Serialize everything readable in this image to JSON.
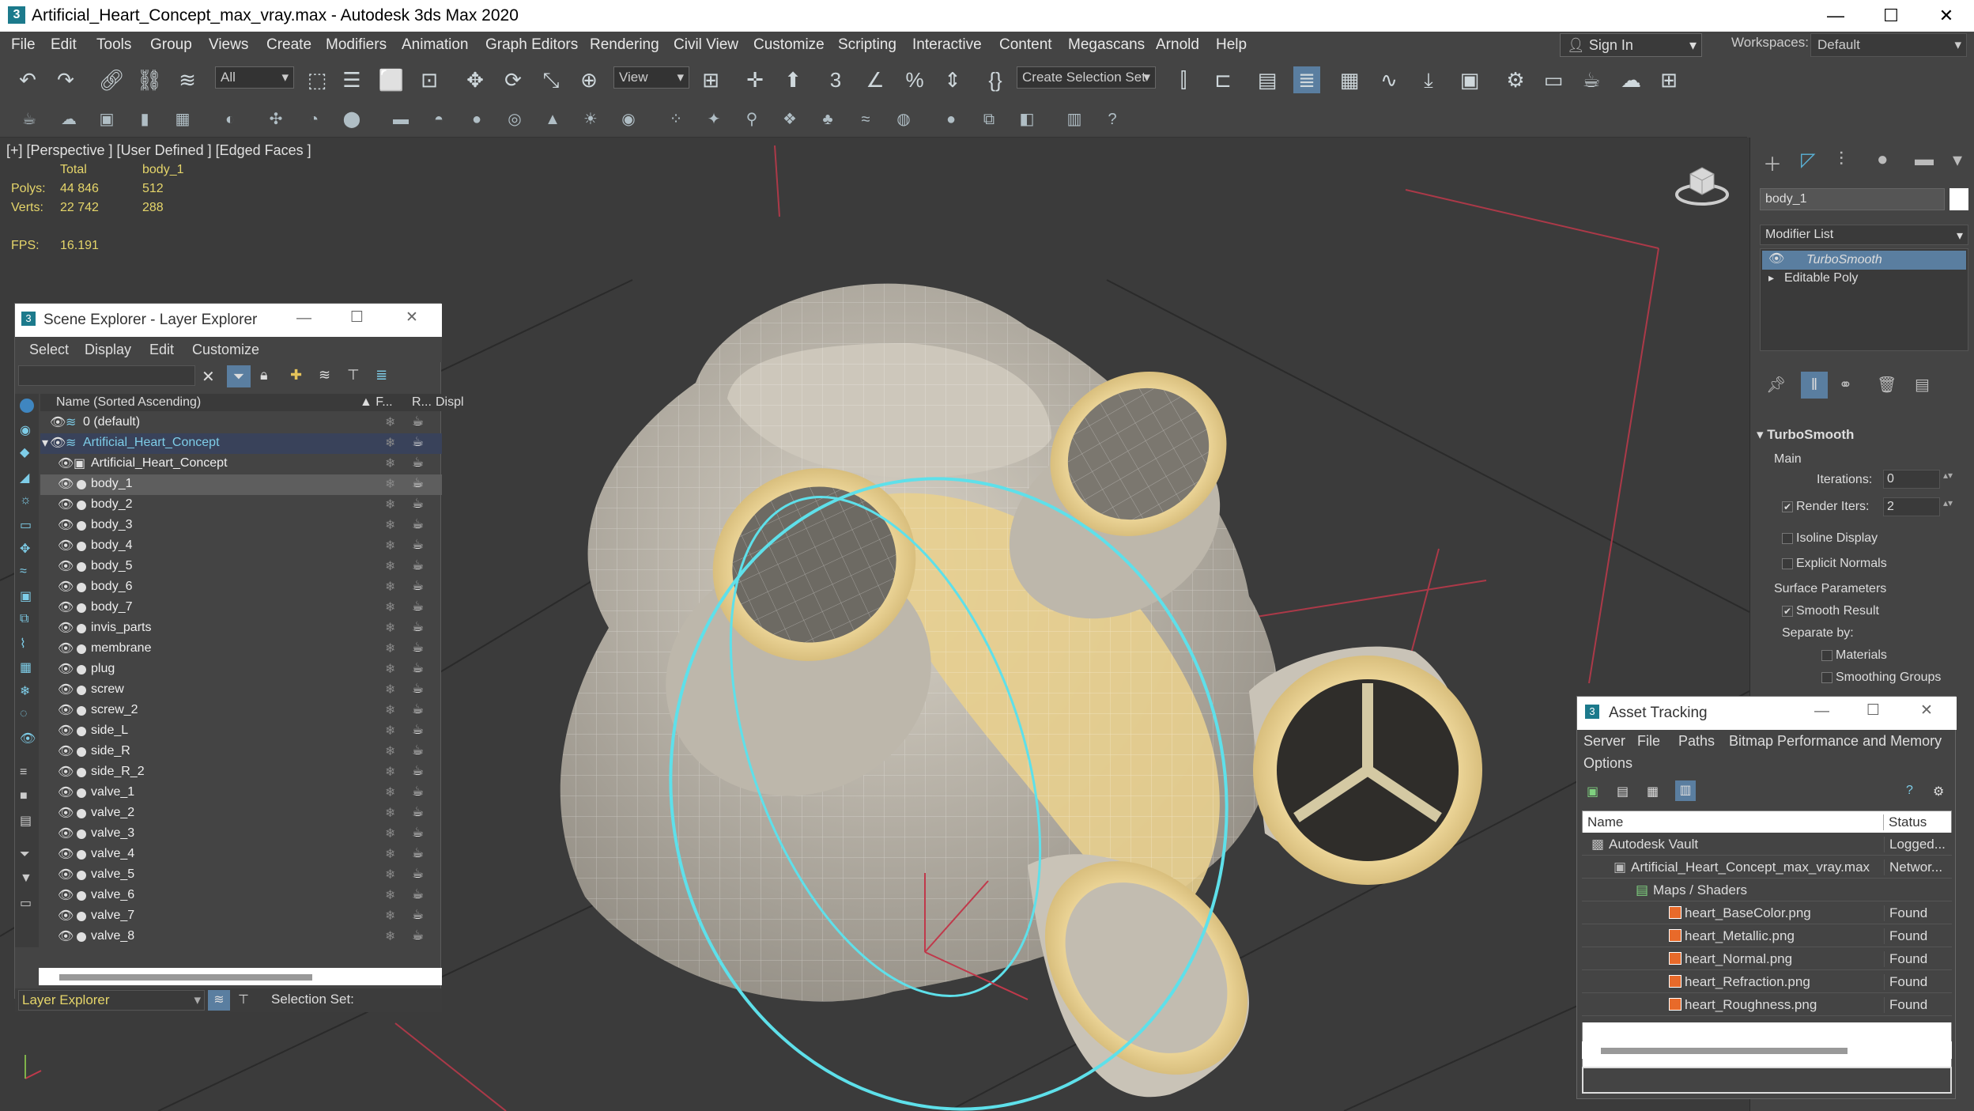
{
  "titlebar": {
    "title": "Artificial_Heart_Concept_max_vray.max - Autodesk 3ds Max 2020",
    "min": "—",
    "max": "☐",
    "close": "✕"
  },
  "menu": [
    "File",
    "Edit",
    "Tools",
    "Group",
    "Views",
    "Create",
    "Modifiers",
    "Animation",
    "Graph Editors",
    "Rendering",
    "Civil View",
    "Customize",
    "Scripting",
    "Interactive",
    "Content",
    "Megascans",
    "Arnold",
    "Help"
  ],
  "signin": "Sign In",
  "workspaces": {
    "label": "Workspaces:",
    "value": "Default"
  },
  "toolbar": {
    "filter": "All",
    "refcoord": "View",
    "selset": "Create Selection Set"
  },
  "viewport": {
    "label": "[+] [Perspective ] [User Defined ] [Edged Faces ]",
    "stats": {
      "total_hdr": "Total",
      "obj_hdr": "body_1",
      "polys_lbl": "Polys:",
      "polys_total": "44 846",
      "polys_obj": "512",
      "verts_lbl": "Verts:",
      "verts_total": "22 742",
      "verts_obj": "288",
      "fps_lbl": "FPS:",
      "fps": "16.191"
    }
  },
  "scene_explorer": {
    "title": "Scene Explorer - Layer Explorer",
    "menu": [
      "Select",
      "Display",
      "Edit",
      "Customize"
    ],
    "col_name": "Name (Sorted Ascending)",
    "col_f": "▲ F...",
    "col_r": "R...",
    "col_d": "Displ",
    "rows": [
      {
        "name": "0 (default)",
        "indent": 0,
        "kind": "layer"
      },
      {
        "name": "Artificial_Heart_Concept",
        "indent": 0,
        "kind": "layer-open"
      },
      {
        "name": "Artificial_Heart_Concept",
        "indent": 1,
        "kind": "group"
      },
      {
        "name": "body_1",
        "indent": 1,
        "kind": "obj",
        "selected": true
      },
      {
        "name": "body_2",
        "indent": 1,
        "kind": "obj"
      },
      {
        "name": "body_3",
        "indent": 1,
        "kind": "obj"
      },
      {
        "name": "body_4",
        "indent": 1,
        "kind": "obj"
      },
      {
        "name": "body_5",
        "indent": 1,
        "kind": "obj"
      },
      {
        "name": "body_6",
        "indent": 1,
        "kind": "obj"
      },
      {
        "name": "body_7",
        "indent": 1,
        "kind": "obj"
      },
      {
        "name": "invis_parts",
        "indent": 1,
        "kind": "obj"
      },
      {
        "name": "membrane",
        "indent": 1,
        "kind": "obj"
      },
      {
        "name": "plug",
        "indent": 1,
        "kind": "obj"
      },
      {
        "name": "screw",
        "indent": 1,
        "kind": "obj"
      },
      {
        "name": "screw_2",
        "indent": 1,
        "kind": "obj"
      },
      {
        "name": "side_L",
        "indent": 1,
        "kind": "obj"
      },
      {
        "name": "side_R",
        "indent": 1,
        "kind": "obj"
      },
      {
        "name": "side_R_2",
        "indent": 1,
        "kind": "obj"
      },
      {
        "name": "valve_1",
        "indent": 1,
        "kind": "obj"
      },
      {
        "name": "valve_2",
        "indent": 1,
        "kind": "obj"
      },
      {
        "name": "valve_3",
        "indent": 1,
        "kind": "obj"
      },
      {
        "name": "valve_4",
        "indent": 1,
        "kind": "obj"
      },
      {
        "name": "valve_5",
        "indent": 1,
        "kind": "obj"
      },
      {
        "name": "valve_6",
        "indent": 1,
        "kind": "obj"
      },
      {
        "name": "valve_7",
        "indent": 1,
        "kind": "obj"
      },
      {
        "name": "valve_8",
        "indent": 1,
        "kind": "obj"
      }
    ],
    "footer_mode": "Layer Explorer",
    "footer_selset": "Selection Set:"
  },
  "command_panel": {
    "object_name": "body_1",
    "modifier_list": "Modifier List",
    "stack": [
      "TurboSmooth",
      "Editable Poly"
    ],
    "rollout": "TurboSmooth",
    "main": "Main",
    "iterations_lbl": "Iterations:",
    "iterations": "0",
    "render_iters_lbl": "Render Iters:",
    "render_iters": "2",
    "isoline": "Isoline Display",
    "explicit": "Explicit Normals",
    "surface": "Surface Parameters",
    "smooth": "Smooth Result",
    "separate": "Separate by:",
    "materials": "Materials",
    "smoothing": "Smoothing Groups"
  },
  "asset_tracking": {
    "title": "Asset Tracking",
    "menu": [
      "Server",
      "File",
      "Paths",
      "Bitmap Performance and Memory",
      "Options"
    ],
    "col_name": "Name",
    "col_status": "Status",
    "rows": [
      {
        "name": "Autodesk Vault",
        "status": "Logged...",
        "indent": 0
      },
      {
        "name": "Artificial_Heart_Concept_max_vray.max",
        "status": "Networ...",
        "indent": 1
      },
      {
        "name": "Maps / Shaders",
        "status": "",
        "indent": 2
      },
      {
        "name": "heart_BaseColor.png",
        "status": "Found",
        "indent": 3
      },
      {
        "name": "heart_Metallic.png",
        "status": "Found",
        "indent": 3
      },
      {
        "name": "heart_Normal.png",
        "status": "Found",
        "indent": 3
      },
      {
        "name": "heart_Refraction.png",
        "status": "Found",
        "indent": 3
      },
      {
        "name": "heart_Roughness.png",
        "status": "Found",
        "indent": 3
      }
    ]
  }
}
